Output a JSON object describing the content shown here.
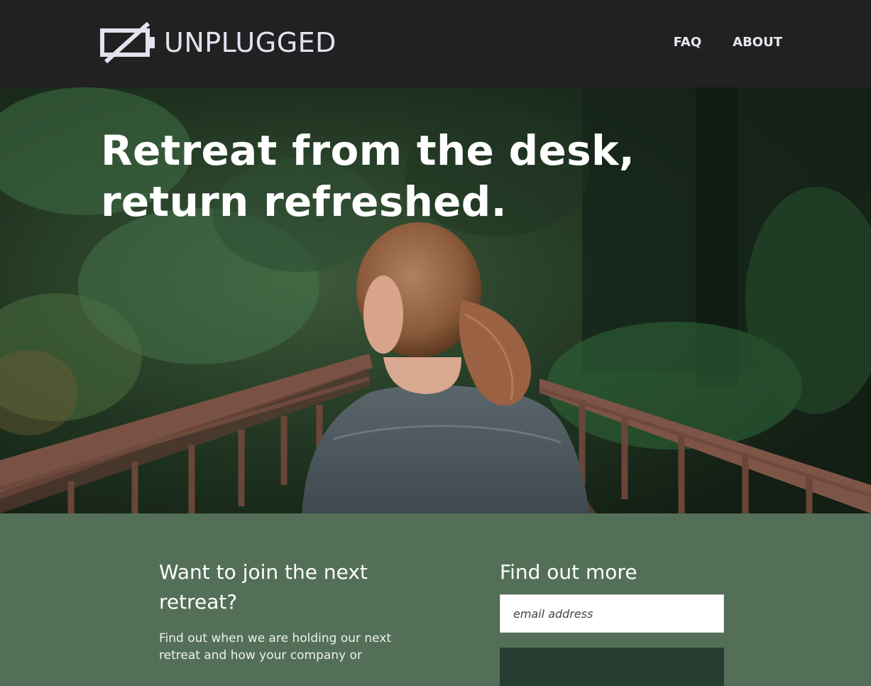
{
  "header": {
    "logo_text": "UNPLUGGED",
    "logo_icon": "unplugged-battery-icon",
    "nav": [
      {
        "label": "FAQ"
      },
      {
        "label": "ABOUT"
      }
    ]
  },
  "hero": {
    "title_line1": "Retreat from the desk,",
    "title_line2": "return refreshed.",
    "image": "woman-on-forest-bridge-photo"
  },
  "signup": {
    "left_heading": "Want to join the next retreat?",
    "left_text": "Find out when we are holding our next retreat and how your company or",
    "right_heading": "Find out more",
    "email_placeholder": "email address"
  },
  "colors": {
    "header_bg": "#212121",
    "section_bg": "#536f58",
    "button_bg": "#263d31",
    "logo_color": "#e4e2ef"
  }
}
